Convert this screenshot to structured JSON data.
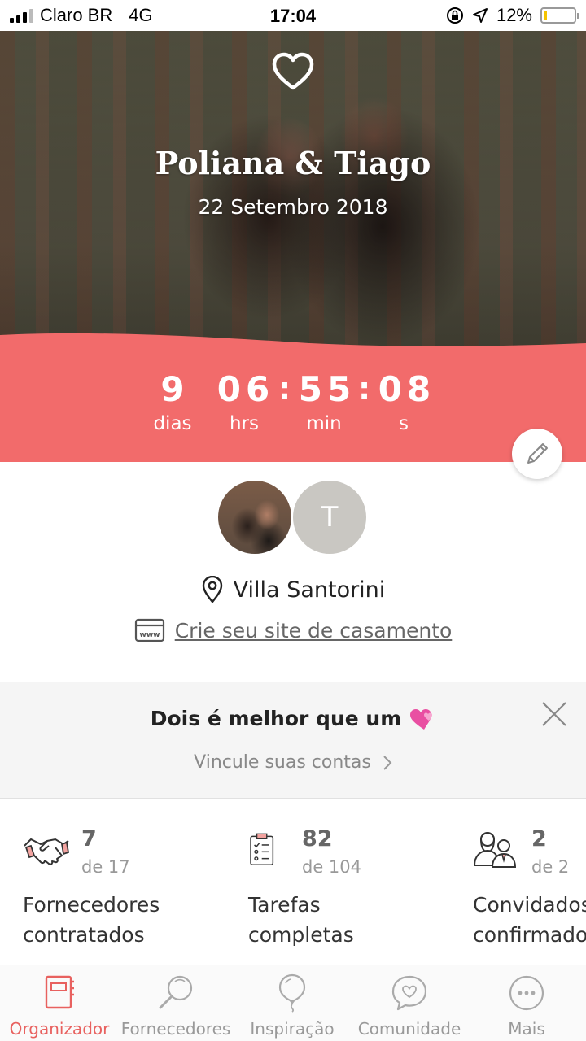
{
  "status_bar": {
    "carrier": "Claro BR",
    "network": "4G",
    "time": "17:04",
    "battery": "12%",
    "battery_level": 0.12
  },
  "hero": {
    "names": "Poliana & Tiago",
    "date": "22 Setembro 2018"
  },
  "countdown": {
    "days": "9",
    "days_label": "dias",
    "hours": "06",
    "hours_label": "hrs",
    "minutes": "55",
    "minutes_label": "min",
    "seconds": "08",
    "seconds_label": "s",
    "separator": ":"
  },
  "profile": {
    "partner_initial": "T",
    "venue": "Villa Santorini",
    "site_link": "Crie seu site de casamento"
  },
  "banner": {
    "title": "Dois é melhor que um",
    "subtitle": "Vincule suas contas"
  },
  "stats": [
    {
      "value": "7",
      "of": "de 17",
      "label_line1": "Fornecedores",
      "label_line2": "contratados",
      "icon": "handshake-icon"
    },
    {
      "value": "82",
      "of": "de 104",
      "label_line1": "Tarefas",
      "label_line2": "completas",
      "icon": "checklist-icon"
    },
    {
      "value": "2",
      "of": "de 2",
      "label_line1": "Convidados",
      "label_line2": "confirmados",
      "icon": "guests-icon"
    }
  ],
  "bottom_nav": [
    {
      "label": "Organizador",
      "icon": "planner-icon",
      "active": true
    },
    {
      "label": "Fornecedores",
      "icon": "search-icon",
      "active": false
    },
    {
      "label": "Inspiração",
      "icon": "balloon-icon",
      "active": false
    },
    {
      "label": "Comunidade",
      "icon": "chat-heart-icon",
      "active": false
    },
    {
      "label": "Mais",
      "icon": "more-icon",
      "active": false
    }
  ],
  "colors": {
    "accent": "#f26b6b",
    "active_nav": "#e8615f"
  }
}
